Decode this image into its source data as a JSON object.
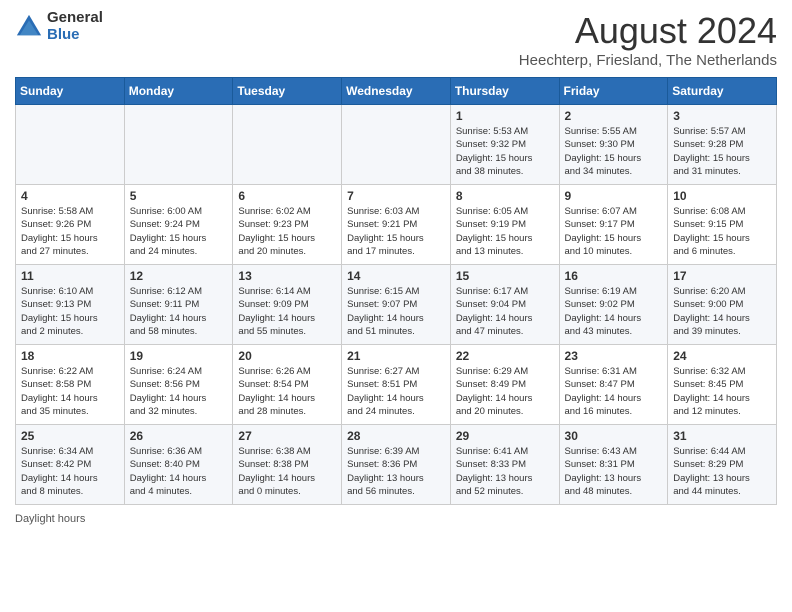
{
  "logo": {
    "general": "General",
    "blue": "Blue"
  },
  "title": "August 2024",
  "subtitle": "Heechterp, Friesland, The Netherlands",
  "days_of_week": [
    "Sunday",
    "Monday",
    "Tuesday",
    "Wednesday",
    "Thursday",
    "Friday",
    "Saturday"
  ],
  "footer": {
    "daylight_label": "Daylight hours"
  },
  "weeks": [
    [
      {
        "day": "",
        "info": ""
      },
      {
        "day": "",
        "info": ""
      },
      {
        "day": "",
        "info": ""
      },
      {
        "day": "",
        "info": ""
      },
      {
        "day": "1",
        "info": "Sunrise: 5:53 AM\nSunset: 9:32 PM\nDaylight: 15 hours\nand 38 minutes."
      },
      {
        "day": "2",
        "info": "Sunrise: 5:55 AM\nSunset: 9:30 PM\nDaylight: 15 hours\nand 34 minutes."
      },
      {
        "day": "3",
        "info": "Sunrise: 5:57 AM\nSunset: 9:28 PM\nDaylight: 15 hours\nand 31 minutes."
      }
    ],
    [
      {
        "day": "4",
        "info": "Sunrise: 5:58 AM\nSunset: 9:26 PM\nDaylight: 15 hours\nand 27 minutes."
      },
      {
        "day": "5",
        "info": "Sunrise: 6:00 AM\nSunset: 9:24 PM\nDaylight: 15 hours\nand 24 minutes."
      },
      {
        "day": "6",
        "info": "Sunrise: 6:02 AM\nSunset: 9:23 PM\nDaylight: 15 hours\nand 20 minutes."
      },
      {
        "day": "7",
        "info": "Sunrise: 6:03 AM\nSunset: 9:21 PM\nDaylight: 15 hours\nand 17 minutes."
      },
      {
        "day": "8",
        "info": "Sunrise: 6:05 AM\nSunset: 9:19 PM\nDaylight: 15 hours\nand 13 minutes."
      },
      {
        "day": "9",
        "info": "Sunrise: 6:07 AM\nSunset: 9:17 PM\nDaylight: 15 hours\nand 10 minutes."
      },
      {
        "day": "10",
        "info": "Sunrise: 6:08 AM\nSunset: 9:15 PM\nDaylight: 15 hours\nand 6 minutes."
      }
    ],
    [
      {
        "day": "11",
        "info": "Sunrise: 6:10 AM\nSunset: 9:13 PM\nDaylight: 15 hours\nand 2 minutes."
      },
      {
        "day": "12",
        "info": "Sunrise: 6:12 AM\nSunset: 9:11 PM\nDaylight: 14 hours\nand 58 minutes."
      },
      {
        "day": "13",
        "info": "Sunrise: 6:14 AM\nSunset: 9:09 PM\nDaylight: 14 hours\nand 55 minutes."
      },
      {
        "day": "14",
        "info": "Sunrise: 6:15 AM\nSunset: 9:07 PM\nDaylight: 14 hours\nand 51 minutes."
      },
      {
        "day": "15",
        "info": "Sunrise: 6:17 AM\nSunset: 9:04 PM\nDaylight: 14 hours\nand 47 minutes."
      },
      {
        "day": "16",
        "info": "Sunrise: 6:19 AM\nSunset: 9:02 PM\nDaylight: 14 hours\nand 43 minutes."
      },
      {
        "day": "17",
        "info": "Sunrise: 6:20 AM\nSunset: 9:00 PM\nDaylight: 14 hours\nand 39 minutes."
      }
    ],
    [
      {
        "day": "18",
        "info": "Sunrise: 6:22 AM\nSunset: 8:58 PM\nDaylight: 14 hours\nand 35 minutes."
      },
      {
        "day": "19",
        "info": "Sunrise: 6:24 AM\nSunset: 8:56 PM\nDaylight: 14 hours\nand 32 minutes."
      },
      {
        "day": "20",
        "info": "Sunrise: 6:26 AM\nSunset: 8:54 PM\nDaylight: 14 hours\nand 28 minutes."
      },
      {
        "day": "21",
        "info": "Sunrise: 6:27 AM\nSunset: 8:51 PM\nDaylight: 14 hours\nand 24 minutes."
      },
      {
        "day": "22",
        "info": "Sunrise: 6:29 AM\nSunset: 8:49 PM\nDaylight: 14 hours\nand 20 minutes."
      },
      {
        "day": "23",
        "info": "Sunrise: 6:31 AM\nSunset: 8:47 PM\nDaylight: 14 hours\nand 16 minutes."
      },
      {
        "day": "24",
        "info": "Sunrise: 6:32 AM\nSunset: 8:45 PM\nDaylight: 14 hours\nand 12 minutes."
      }
    ],
    [
      {
        "day": "25",
        "info": "Sunrise: 6:34 AM\nSunset: 8:42 PM\nDaylight: 14 hours\nand 8 minutes."
      },
      {
        "day": "26",
        "info": "Sunrise: 6:36 AM\nSunset: 8:40 PM\nDaylight: 14 hours\nand 4 minutes."
      },
      {
        "day": "27",
        "info": "Sunrise: 6:38 AM\nSunset: 8:38 PM\nDaylight: 14 hours\nand 0 minutes."
      },
      {
        "day": "28",
        "info": "Sunrise: 6:39 AM\nSunset: 8:36 PM\nDaylight: 13 hours\nand 56 minutes."
      },
      {
        "day": "29",
        "info": "Sunrise: 6:41 AM\nSunset: 8:33 PM\nDaylight: 13 hours\nand 52 minutes."
      },
      {
        "day": "30",
        "info": "Sunrise: 6:43 AM\nSunset: 8:31 PM\nDaylight: 13 hours\nand 48 minutes."
      },
      {
        "day": "31",
        "info": "Sunrise: 6:44 AM\nSunset: 8:29 PM\nDaylight: 13 hours\nand 44 minutes."
      }
    ]
  ]
}
